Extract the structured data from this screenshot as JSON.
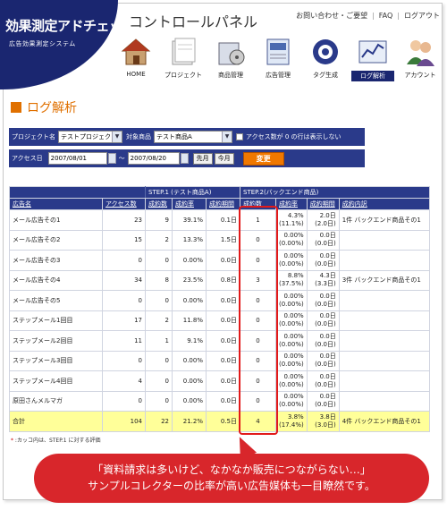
{
  "brand": {
    "title": "効果測定アドチェック",
    "subtitle": "広告効果測定システム"
  },
  "header": {
    "panel_title": "コントロールパネル",
    "links": [
      "お問い合わせ・ご要望",
      "FAQ",
      "ログアウト"
    ]
  },
  "nav": [
    {
      "label": "HOME",
      "icon": "home-icon"
    },
    {
      "label": "プロジェクト",
      "icon": "folder-icon"
    },
    {
      "label": "商品管理",
      "icon": "product-box-icon"
    },
    {
      "label": "広告管理",
      "icon": "ad-document-icon"
    },
    {
      "label": "タグ生成",
      "icon": "tag-gear-icon"
    },
    {
      "label": "ログ解析",
      "icon": "chart-log-icon",
      "active": true
    },
    {
      "label": "アカウント",
      "icon": "users-icon"
    }
  ],
  "page_title": "ログ解析",
  "filters": {
    "project_label": "プロジェクト名",
    "project_value": "テストプロジェクト",
    "product_label": "対象商品",
    "product_value": "テスト商品A",
    "hide_zero_label": "アクセス数が 0 の行は表示しない",
    "date_label": "アクセス日",
    "date_from": "2007/08/01",
    "date_to": "2007/08/20",
    "tilde": "～",
    "prev_month": "先月",
    "this_month": "今月",
    "apply": "変更"
  },
  "table": {
    "group_step1": "STEP.1 (テスト商品A)",
    "group_step2": "STEP.2(バックエンド商品)",
    "columns": [
      "広告名",
      "アクセス数",
      "成約数",
      "成約率",
      "成約期間",
      "成約数",
      "成約率",
      "成約期間",
      "成約内訳"
    ],
    "rows": [
      {
        "name": "メール広告その1",
        "access": "23",
        "conv": "9",
        "rate": "39.1%",
        "period": "0.1日",
        "conv2": "1",
        "rate2a": "4.3%",
        "rate2b": "(11.1%)",
        "period2a": "2.0日",
        "period2b": "(2.0日)",
        "detail": "1件 バックエンド商品その1"
      },
      {
        "name": "メール広告その2",
        "access": "15",
        "conv": "2",
        "rate": "13.3%",
        "period": "1.5日",
        "conv2": "0",
        "rate2a": "0.00%",
        "rate2b": "(0.00%)",
        "period2a": "0.0日",
        "period2b": "(0.0日)",
        "detail": ""
      },
      {
        "name": "メール広告その3",
        "access": "0",
        "conv": "0",
        "rate": "0.00%",
        "period": "0.0日",
        "conv2": "0",
        "rate2a": "0.00%",
        "rate2b": "(0.00%)",
        "period2a": "0.0日",
        "period2b": "(0.0日)",
        "detail": ""
      },
      {
        "name": "メール広告その4",
        "access": "34",
        "conv": "8",
        "rate": "23.5%",
        "period": "0.8日",
        "conv2": "3",
        "rate2a": "8.8%",
        "rate2b": "(37.5%)",
        "period2a": "4.3日",
        "period2b": "(3.3日)",
        "detail": "3件 バックエンド商品その1"
      },
      {
        "name": "メール広告その5",
        "access": "0",
        "conv": "0",
        "rate": "0.00%",
        "period": "0.0日",
        "conv2": "0",
        "rate2a": "0.00%",
        "rate2b": "(0.00%)",
        "period2a": "0.0日",
        "period2b": "(0.0日)",
        "detail": ""
      },
      {
        "name": "ステップメール1回目",
        "access": "17",
        "conv": "2",
        "rate": "11.8%",
        "period": "0.0日",
        "conv2": "0",
        "rate2a": "0.00%",
        "rate2b": "(0.00%)",
        "period2a": "0.0日",
        "period2b": "(0.0日)",
        "detail": ""
      },
      {
        "name": "ステップメール2回目",
        "access": "11",
        "conv": "1",
        "rate": "9.1%",
        "period": "0.0日",
        "conv2": "0",
        "rate2a": "0.00%",
        "rate2b": "(0.00%)",
        "period2a": "0.0日",
        "period2b": "(0.0日)",
        "detail": ""
      },
      {
        "name": "ステップメール3回目",
        "access": "0",
        "conv": "0",
        "rate": "0.00%",
        "period": "0.0日",
        "conv2": "0",
        "rate2a": "0.00%",
        "rate2b": "(0.00%)",
        "period2a": "0.0日",
        "period2b": "(0.0日)",
        "detail": ""
      },
      {
        "name": "ステップメール4回目",
        "access": "4",
        "conv": "0",
        "rate": "0.00%",
        "period": "0.0日",
        "conv2": "0",
        "rate2a": "0.00%",
        "rate2b": "(0.00%)",
        "period2a": "0.0日",
        "period2b": "(0.0日)",
        "detail": ""
      },
      {
        "name": "原田さんメルマガ",
        "access": "0",
        "conv": "0",
        "rate": "0.00%",
        "period": "0.0日",
        "conv2": "0",
        "rate2a": "0.00%",
        "rate2b": "(0.00%)",
        "period2a": "0.0日",
        "period2b": "(0.0日)",
        "detail": ""
      }
    ],
    "total": {
      "name": "合計",
      "access": "104",
      "conv": "22",
      "rate": "21.2%",
      "period": "0.5日",
      "conv2": "4",
      "rate2a": "3.8%",
      "rate2b": "(17.4%)",
      "period2a": "3.8日",
      "period2b": "(3.0日)",
      "detail": "4件 バックエンド商品その1"
    }
  },
  "footnote": {
    "star": "*",
    "text": ":カッコ内は、STEP.1 に対する評価"
  },
  "callout": {
    "line1": "「資料請求は多いけど、なかなか販売につながらない…」",
    "line2": "サンプルコレクターの比率が高い広告媒体も一目瞭然です。"
  },
  "colors": {
    "navy": "#2a3a8a",
    "orange": "#e07000",
    "highlight_red": "#e21a1a",
    "total_row": "#ffff99"
  }
}
